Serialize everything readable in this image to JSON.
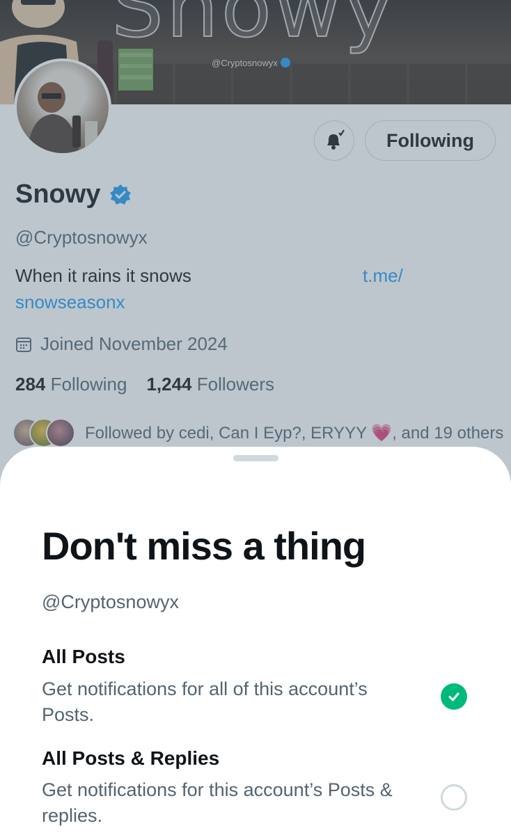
{
  "banner": {
    "title": "Snowy",
    "handle": "@Cryptosnowyx"
  },
  "profile": {
    "display_name": "Snowy",
    "handle": "@Cryptosnowyx",
    "bio_text": "When it rains it snows",
    "bio_link_part1": "t.me/",
    "bio_link_part2": "snowseasonx",
    "joined": "Joined November 2024",
    "following_count": "284",
    "following_label": "Following",
    "followers_count": "1,244",
    "followers_label": "Followers",
    "followed_by": "Followed by cedi, Can I Eyp?, ERYYY 💗, and 19 others",
    "following_button": "Following"
  },
  "sheet": {
    "title": "Don't miss a thing",
    "handle": "@Cryptosnowyx",
    "options": [
      {
        "title": "All Posts",
        "description": "Get notifications for all of this account’s Posts.",
        "selected": true
      },
      {
        "title": "All Posts & Replies",
        "description": "Get notifications for this account’s Posts & replies.",
        "selected": false
      }
    ]
  },
  "colors": {
    "accent": "#1d9bf0",
    "selected": "#00ba7c",
    "secondary_text": "#536471"
  },
  "icons": [
    "bell-check-icon",
    "verified-badge-icon",
    "calendar-icon",
    "check-icon"
  ]
}
